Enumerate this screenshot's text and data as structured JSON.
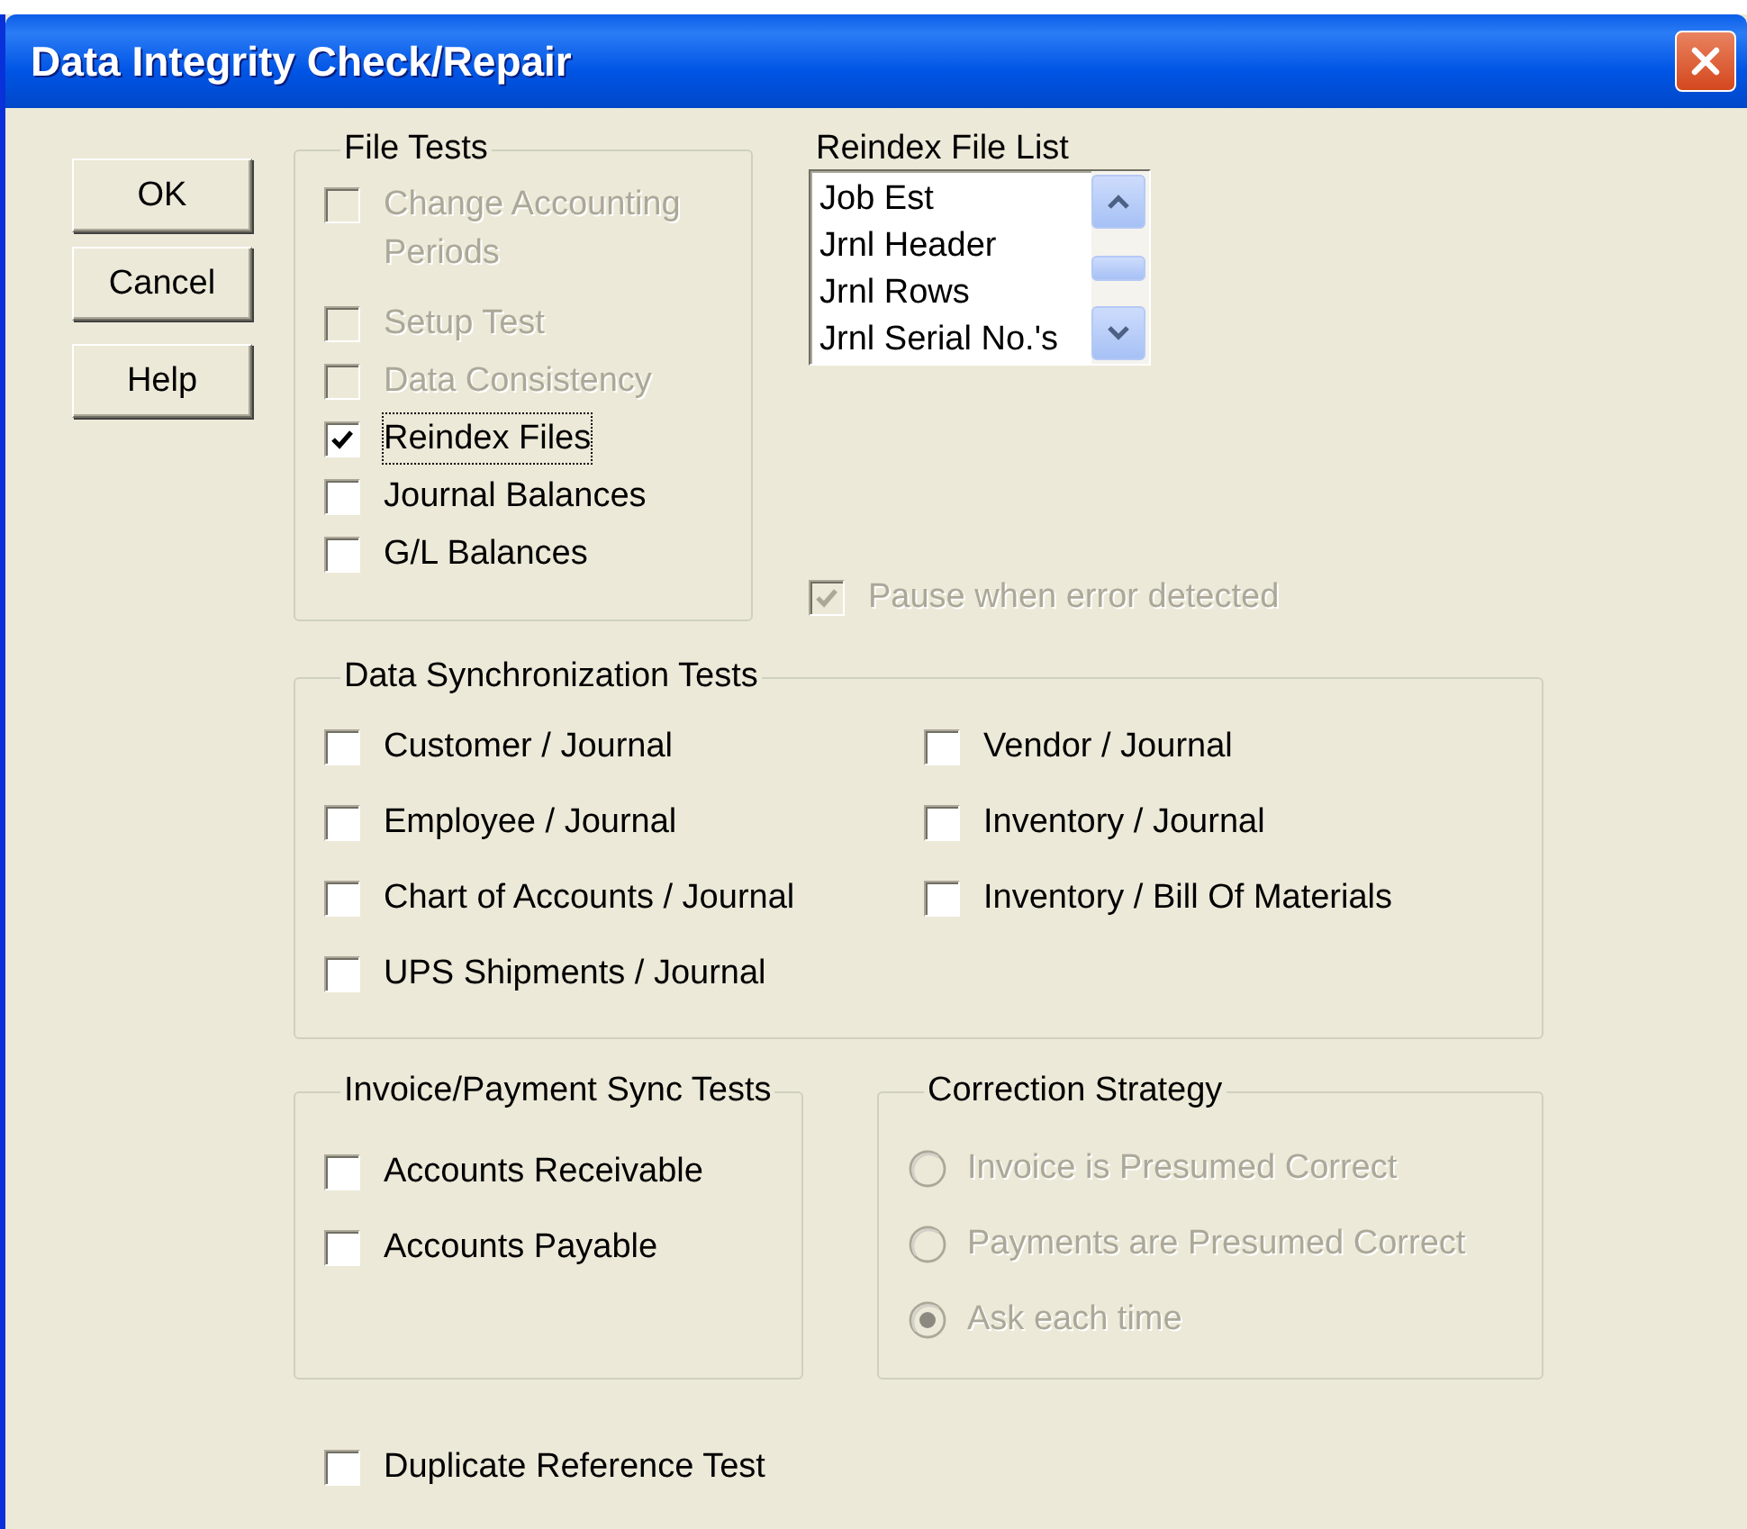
{
  "window": {
    "title": "Data Integrity Check/Repair"
  },
  "buttons": [
    {
      "label": "OK"
    },
    {
      "label": "Cancel"
    },
    {
      "label": "Help"
    }
  ],
  "file_tests": {
    "title": "File Tests",
    "items": [
      {
        "label": "Change Accounting Periods",
        "checked": false,
        "disabled": true,
        "focused": false
      },
      {
        "label": "Setup Test",
        "checked": false,
        "disabled": true,
        "focused": false
      },
      {
        "label": "Data Consistency",
        "checked": false,
        "disabled": true,
        "focused": false
      },
      {
        "label": "Reindex Files",
        "checked": true,
        "disabled": false,
        "focused": true
      },
      {
        "label": "Journal Balances",
        "checked": false,
        "disabled": false,
        "focused": false
      },
      {
        "label": "G/L Balances",
        "checked": false,
        "disabled": false,
        "focused": false
      }
    ]
  },
  "reindex_file_list": {
    "title": "Reindex File List",
    "items": [
      "Job Est",
      "Jrnl Header",
      "Jrnl Rows",
      "Jrnl Serial No.'s"
    ]
  },
  "pause_when_error": {
    "label": "Pause when error detected",
    "checked": true,
    "disabled": true
  },
  "data_sync_tests": {
    "title": "Data Synchronization Tests",
    "items": [
      {
        "label": "Customer / Journal",
        "checked": false
      },
      {
        "label": "Vendor / Journal",
        "checked": false
      },
      {
        "label": "Employee / Journal",
        "checked": false
      },
      {
        "label": "Inventory / Journal",
        "checked": false
      },
      {
        "label": "Chart of Accounts / Journal",
        "checked": false
      },
      {
        "label": "Inventory / Bill Of Materials",
        "checked": false
      },
      {
        "label": "UPS Shipments / Journal",
        "checked": false
      }
    ]
  },
  "invoice_payment_sync_tests": {
    "title": "Invoice/Payment Sync Tests",
    "items": [
      {
        "label": "Accounts Receivable",
        "checked": false
      },
      {
        "label": "Accounts Payable",
        "checked": false
      }
    ]
  },
  "correction_strategy": {
    "title": "Correction Strategy",
    "options": [
      {
        "label": "Invoice is Presumed Correct",
        "selected": false,
        "disabled": true
      },
      {
        "label": "Payments are Presumed Correct",
        "selected": false,
        "disabled": true
      },
      {
        "label": "Ask each time",
        "selected": true,
        "disabled": true
      }
    ]
  },
  "duplicate_reference_test": {
    "label": "Duplicate Reference Test",
    "checked": false
  }
}
